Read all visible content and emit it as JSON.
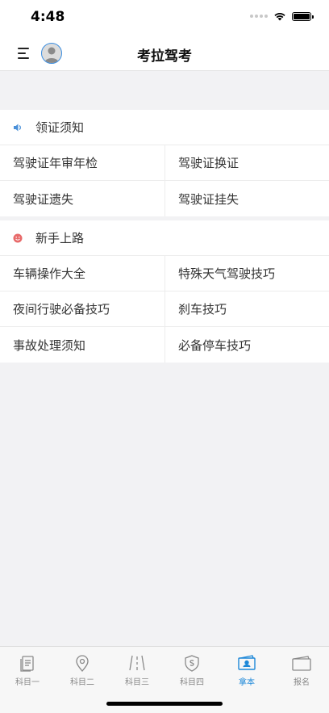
{
  "status": {
    "time": "4:48"
  },
  "nav": {
    "title": "考拉驾考"
  },
  "sections": [
    {
      "title": "领证须知",
      "icon": "speaker-icon",
      "icon_color": "#4a90d9",
      "items": [
        "驾驶证年审年检",
        "驾驶证换证",
        "驾驶证遗失",
        "驾驶证挂失"
      ]
    },
    {
      "title": "新手上路",
      "icon": "smiley-icon",
      "icon_color": "#e86a6a",
      "items": [
        "车辆操作大全",
        "特殊天气驾驶技巧",
        "夜间行驶必备技巧",
        "刹车技巧",
        "事故处理须知",
        "必备停车技巧"
      ]
    }
  ],
  "tabs": [
    {
      "label": "科目一",
      "icon": "document-icon",
      "active": false
    },
    {
      "label": "科目二",
      "icon": "location-pin-icon",
      "active": false
    },
    {
      "label": "科目三",
      "icon": "road-icon",
      "active": false
    },
    {
      "label": "科目四",
      "icon": "shield-s-icon",
      "active": false
    },
    {
      "label": "拿本",
      "icon": "license-card-icon",
      "active": true
    },
    {
      "label": "报名",
      "icon": "wallet-icon",
      "active": false
    }
  ],
  "colors": {
    "accent": "#1e88d8",
    "inactive": "#888888"
  }
}
